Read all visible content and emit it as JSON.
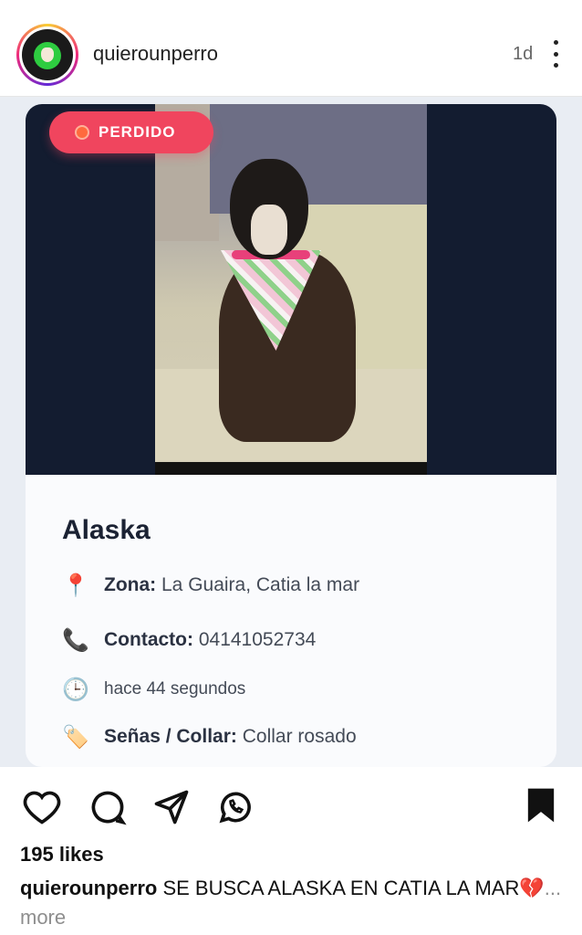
{
  "header": {
    "username": "quierounperro",
    "time": "1d"
  },
  "card": {
    "badge": "PERDIDO",
    "pet_name": "Alaska",
    "zona_label": "Zona:",
    "zona_value": "La Guaira, Catia la mar",
    "contacto_label": "Contacto:",
    "contacto_value": "04141052734",
    "time_ago": "hace 44 segundos",
    "senas_label": "Señas / Collar:",
    "senas_value": "Collar rosado"
  },
  "footer": {
    "likes": "195 likes",
    "caption_user": "quierounperro",
    "caption_text": "SE BUSCA ALASKA EN CATIA LA MAR💔",
    "more": "... more"
  },
  "colors": {
    "badge": "#f0455e",
    "card_dark": "#131c30"
  },
  "icons": {
    "zona": "pin-icon",
    "contacto": "phone-icon",
    "time": "clock-icon",
    "senas": "tag-icon"
  }
}
